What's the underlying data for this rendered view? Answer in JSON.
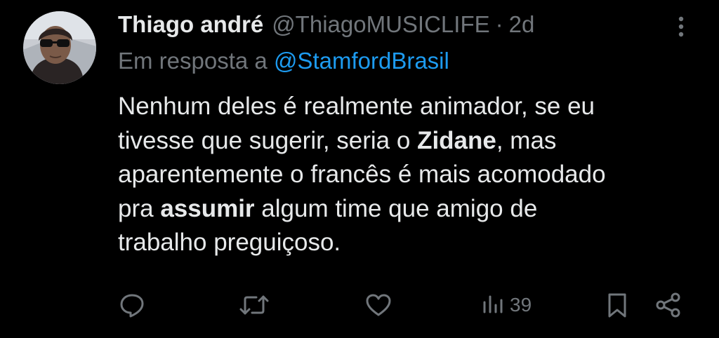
{
  "author": {
    "name": "Thiago andré",
    "handle": "@ThiagoMUSICLIFE",
    "separator": "·",
    "time": "2d"
  },
  "reply": {
    "prefix": "Em resposta a",
    "mention": "@StamfordBrasil"
  },
  "body": {
    "line1": "Nenhum deles é realmente animador, se eu",
    "line2_a": "tivesse que sugerir, seria o ",
    "line2_bold": "Zidane",
    "line2_b": ", mas",
    "line3": "aparentemente o francês é mais acomodado",
    "line4_a": "pra ",
    "line4_bold": "assumir",
    "line4_b": " algum time que amigo de",
    "line5": "trabalho preguiçoso."
  },
  "actions": {
    "views": "39",
    "icons": [
      "reply-icon",
      "retweet-icon",
      "like-icon",
      "views-icon",
      "bookmark-icon",
      "share-icon"
    ]
  },
  "colors": {
    "background": "#000000",
    "text": "#e7e9ea",
    "muted": "#71767b",
    "accent": "#1d9bf0"
  }
}
